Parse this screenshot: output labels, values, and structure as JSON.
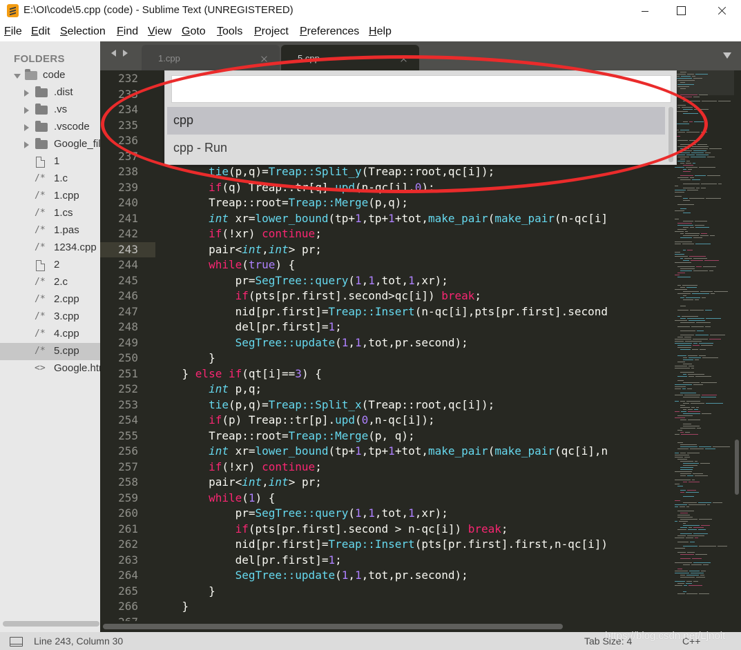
{
  "window": {
    "title": "E:\\OI\\code\\5.cpp (code) - Sublime Text (UNREGISTERED)"
  },
  "menu": [
    "File",
    "Edit",
    "Selection",
    "Find",
    "View",
    "Goto",
    "Tools",
    "Project",
    "Preferences",
    "Help"
  ],
  "sidebar": {
    "title": "FOLDERS",
    "items": [
      {
        "label": "code",
        "kind": "folder",
        "state": "open"
      },
      {
        "label": ".dist",
        "kind": "folder",
        "state": "closed"
      },
      {
        "label": ".vs",
        "kind": "folder",
        "state": "closed"
      },
      {
        "label": ".vscode",
        "kind": "folder",
        "state": "closed"
      },
      {
        "label": "Google_fil",
        "kind": "folder",
        "state": "closed"
      },
      {
        "label": "1",
        "kind": "file",
        "icon": "document-icon"
      },
      {
        "label": "1.c",
        "kind": "file",
        "icon": "comment-file-icon",
        "glyph": "/*"
      },
      {
        "label": "1.cpp",
        "kind": "file",
        "icon": "comment-file-icon",
        "glyph": "/*"
      },
      {
        "label": "1.cs",
        "kind": "file",
        "icon": "comment-file-icon",
        "glyph": "/*"
      },
      {
        "label": "1.pas",
        "kind": "file",
        "icon": "comment-file-icon",
        "glyph": "/*"
      },
      {
        "label": "1234.cpp",
        "kind": "file",
        "icon": "comment-file-icon",
        "glyph": "/*"
      },
      {
        "label": "2",
        "kind": "file",
        "icon": "document-icon"
      },
      {
        "label": "2.c",
        "kind": "file",
        "icon": "comment-file-icon",
        "glyph": "/*"
      },
      {
        "label": "2.cpp",
        "kind": "file",
        "icon": "comment-file-icon",
        "glyph": "/*"
      },
      {
        "label": "3.cpp",
        "kind": "file",
        "icon": "comment-file-icon",
        "glyph": "/*"
      },
      {
        "label": "4.cpp",
        "kind": "file",
        "icon": "comment-file-icon",
        "glyph": "/*"
      },
      {
        "label": "5.cpp",
        "kind": "file",
        "icon": "comment-file-icon",
        "glyph": "/*",
        "selected": true
      },
      {
        "label": "Google.htr",
        "kind": "file",
        "icon": "html-file-icon",
        "glyph": "<>"
      }
    ]
  },
  "tabs": [
    {
      "label": "1.cpp",
      "active": false
    },
    {
      "label": "5.cpp",
      "active": true
    }
  ],
  "command_palette": {
    "input_value": "",
    "items": [
      {
        "label": "cpp",
        "selected": true
      },
      {
        "label": "cpp - Run",
        "selected": false
      }
    ]
  },
  "editor": {
    "current_line": 243,
    "line_numbers": [
      "232",
      "233",
      "234",
      "235",
      "236",
      "237",
      "238",
      "239",
      "240",
      "241",
      "242",
      "243",
      "244",
      "245",
      "246",
      "247",
      "248",
      "249",
      "250",
      "251",
      "252",
      "253",
      "254",
      "255",
      "256",
      "257",
      "258",
      "259",
      "260",
      "261",
      "262",
      "263",
      "264",
      "265",
      "266",
      "267"
    ],
    "code_lines": [
      {
        "line": "238",
        "tokens": [
          [
            "",
            "        "
          ],
          [
            "fn",
            "tie"
          ],
          [
            "",
            "(p,q)="
          ],
          [
            "fn",
            "Treap::Split_y"
          ],
          [
            "",
            "(Treap::root,qc[i]);"
          ]
        ]
      },
      {
        "line": "239",
        "tokens": [
          [
            "",
            "        "
          ],
          [
            "kw",
            "if"
          ],
          [
            "",
            "(q) Treap::tr[q]."
          ],
          [
            "fn",
            "upd"
          ],
          [
            "",
            "(n-qc[i],"
          ],
          [
            "num",
            "0"
          ],
          [
            "",
            ");"
          ]
        ]
      },
      {
        "line": "240",
        "tokens": [
          [
            "",
            "        Treap::root="
          ],
          [
            "fn",
            "Treap::Merge"
          ],
          [
            "",
            "(p,q);"
          ]
        ]
      },
      {
        "line": "241",
        "tokens": [
          [
            "",
            "        "
          ],
          [
            "type",
            "int"
          ],
          [
            "",
            " xr="
          ],
          [
            "fn",
            "lower_bound"
          ],
          [
            "",
            "(tp+"
          ],
          [
            "num",
            "1"
          ],
          [
            "",
            ",tp+"
          ],
          [
            "num",
            "1"
          ],
          [
            "",
            "+tot,"
          ],
          [
            "fn",
            "make_pair"
          ],
          [
            "",
            "("
          ],
          [
            "fn",
            "make_pair"
          ],
          [
            "",
            "(n-qc[i]"
          ]
        ]
      },
      {
        "line": "242",
        "tokens": [
          [
            "",
            "        "
          ],
          [
            "kw",
            "if"
          ],
          [
            "",
            "(!xr) "
          ],
          [
            "kw",
            "continue"
          ],
          [
            "",
            ";"
          ]
        ]
      },
      {
        "line": "243",
        "tokens": [
          [
            "",
            "        pair<"
          ],
          [
            "type",
            "int"
          ],
          [
            "",
            ","
          ],
          [
            "type",
            "int"
          ],
          [
            "",
            "> pr;"
          ]
        ]
      },
      {
        "line": "244",
        "tokens": [
          [
            "",
            "        "
          ],
          [
            "kw",
            "while"
          ],
          [
            "",
            "("
          ],
          [
            "num",
            "true"
          ],
          [
            "",
            ") {"
          ]
        ]
      },
      {
        "line": "245",
        "tokens": [
          [
            "",
            "            pr="
          ],
          [
            "fn",
            "SegTree::query"
          ],
          [
            "",
            "("
          ],
          [
            "num",
            "1"
          ],
          [
            "",
            ","
          ],
          [
            "num",
            "1"
          ],
          [
            "",
            ",tot,"
          ],
          [
            "num",
            "1"
          ],
          [
            "",
            ",xr);"
          ]
        ]
      },
      {
        "line": "246",
        "tokens": [
          [
            "",
            "            "
          ],
          [
            "kw",
            "if"
          ],
          [
            "",
            "(pts[pr.first].second>qc[i]) "
          ],
          [
            "kw",
            "break"
          ],
          [
            "",
            ";"
          ]
        ]
      },
      {
        "line": "247",
        "tokens": [
          [
            "",
            "            nid[pr.first]="
          ],
          [
            "fn",
            "Treap::Insert"
          ],
          [
            "",
            "(n-qc[i],pts[pr.first].second"
          ]
        ]
      },
      {
        "line": "248",
        "tokens": [
          [
            "",
            "            del[pr.first]="
          ],
          [
            "num",
            "1"
          ],
          [
            "",
            ";"
          ]
        ]
      },
      {
        "line": "249",
        "tokens": [
          [
            "",
            "            "
          ],
          [
            "fn",
            "SegTree::update"
          ],
          [
            "",
            "("
          ],
          [
            "num",
            "1"
          ],
          [
            "",
            ","
          ],
          [
            "num",
            "1"
          ],
          [
            "",
            ",tot,pr.second);"
          ]
        ]
      },
      {
        "line": "250",
        "tokens": [
          [
            "",
            "        }"
          ]
        ]
      },
      {
        "line": "251",
        "tokens": [
          [
            "",
            "    } "
          ],
          [
            "kw",
            "else"
          ],
          [
            "",
            " "
          ],
          [
            "kw",
            "if"
          ],
          [
            "",
            "(qt[i]=="
          ],
          [
            "num",
            "3"
          ],
          [
            "",
            ") {"
          ]
        ]
      },
      {
        "line": "252",
        "tokens": [
          [
            "",
            "        "
          ],
          [
            "type",
            "int"
          ],
          [
            "",
            " p,q;"
          ]
        ]
      },
      {
        "line": "253",
        "tokens": [
          [
            "",
            "        "
          ],
          [
            "fn",
            "tie"
          ],
          [
            "",
            "(p,q)="
          ],
          [
            "fn",
            "Treap::Split_x"
          ],
          [
            "",
            "(Treap::root,qc[i]);"
          ]
        ]
      },
      {
        "line": "254",
        "tokens": [
          [
            "",
            "        "
          ],
          [
            "kw",
            "if"
          ],
          [
            "",
            "(p) Treap::tr[p]."
          ],
          [
            "fn",
            "upd"
          ],
          [
            "",
            "("
          ],
          [
            "num",
            "0"
          ],
          [
            "",
            ",n-qc[i]);"
          ]
        ]
      },
      {
        "line": "255",
        "tokens": [
          [
            "",
            "        Treap::root="
          ],
          [
            "fn",
            "Treap::Merge"
          ],
          [
            "",
            "(p, q);"
          ]
        ]
      },
      {
        "line": "256",
        "tokens": [
          [
            "",
            "        "
          ],
          [
            "type",
            "int"
          ],
          [
            "",
            " xr="
          ],
          [
            "fn",
            "lower_bound"
          ],
          [
            "",
            "(tp+"
          ],
          [
            "num",
            "1"
          ],
          [
            "",
            ",tp+"
          ],
          [
            "num",
            "1"
          ],
          [
            "",
            "+tot,"
          ],
          [
            "fn",
            "make_pair"
          ],
          [
            "",
            "("
          ],
          [
            "fn",
            "make_pair"
          ],
          [
            "",
            "(qc[i],n"
          ]
        ]
      },
      {
        "line": "257",
        "tokens": [
          [
            "",
            "        "
          ],
          [
            "kw",
            "if"
          ],
          [
            "",
            "(!xr) "
          ],
          [
            "kw",
            "continue"
          ],
          [
            "",
            ";"
          ]
        ]
      },
      {
        "line": "258",
        "tokens": [
          [
            "",
            "        pair<"
          ],
          [
            "type",
            "int"
          ],
          [
            "",
            ","
          ],
          [
            "type",
            "int"
          ],
          [
            "",
            "> pr;"
          ]
        ]
      },
      {
        "line": "259",
        "tokens": [
          [
            "",
            "        "
          ],
          [
            "kw",
            "while"
          ],
          [
            "",
            "("
          ],
          [
            "num",
            "1"
          ],
          [
            "",
            ") {"
          ]
        ]
      },
      {
        "line": "260",
        "tokens": [
          [
            "",
            "            pr="
          ],
          [
            "fn",
            "SegTree::query"
          ],
          [
            "",
            "("
          ],
          [
            "num",
            "1"
          ],
          [
            "",
            ","
          ],
          [
            "num",
            "1"
          ],
          [
            "",
            ",tot,"
          ],
          [
            "num",
            "1"
          ],
          [
            "",
            ",xr);"
          ]
        ]
      },
      {
        "line": "261",
        "tokens": [
          [
            "",
            "            "
          ],
          [
            "kw",
            "if"
          ],
          [
            "",
            "(pts[pr.first].second > n-qc[i]) "
          ],
          [
            "kw",
            "break"
          ],
          [
            "",
            ";"
          ]
        ]
      },
      {
        "line": "262",
        "tokens": [
          [
            "",
            "            nid[pr.first]="
          ],
          [
            "fn",
            "Treap::Insert"
          ],
          [
            "",
            "(pts[pr.first].first,n-qc[i])"
          ]
        ]
      },
      {
        "line": "263",
        "tokens": [
          [
            "",
            "            del[pr.first]="
          ],
          [
            "num",
            "1"
          ],
          [
            "",
            ";"
          ]
        ]
      },
      {
        "line": "264",
        "tokens": [
          [
            "",
            "            "
          ],
          [
            "fn",
            "SegTree::update"
          ],
          [
            "",
            "("
          ],
          [
            "num",
            "1"
          ],
          [
            "",
            ","
          ],
          [
            "num",
            "1"
          ],
          [
            "",
            ",tot,pr.second);"
          ]
        ]
      },
      {
        "line": "265",
        "tokens": [
          [
            "",
            "        }"
          ]
        ]
      },
      {
        "line": "266",
        "tokens": [
          [
            "",
            "    }"
          ]
        ]
      }
    ]
  },
  "status": {
    "position": "Line 243, Column 30",
    "tab_size": "Tab Size: 4",
    "syntax": "C++"
  },
  "watermark": "https://blog.csdn.net/Ljnoit",
  "colors": {
    "editor_bg": "#272822",
    "keyword": "#f92672",
    "function": "#66d9ef",
    "number": "#ae81ff",
    "annotation": "#ea2b2b"
  }
}
